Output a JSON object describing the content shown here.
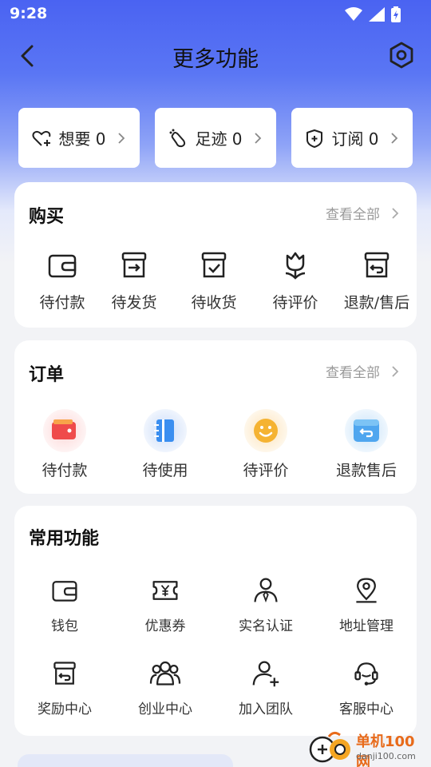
{
  "status_bar": {
    "time": "9:28"
  },
  "nav": {
    "title": "更多功能"
  },
  "quick": [
    {
      "label": "想要 0",
      "icon": "heart-plus-icon"
    },
    {
      "label": "足迹 0",
      "icon": "footprint-icon"
    },
    {
      "label": "订阅 0",
      "icon": "subscribe-icon"
    }
  ],
  "purchase": {
    "title": "购买",
    "view_all": "查看全部",
    "items": [
      {
        "label": "待付款",
        "icon": "wallet-icon"
      },
      {
        "label": "待发货",
        "icon": "box-arrow-icon"
      },
      {
        "label": "待收货",
        "icon": "box-check-icon"
      },
      {
        "label": "待评价",
        "icon": "flower-icon"
      },
      {
        "label": "退款/售后",
        "icon": "box-return-icon"
      }
    ]
  },
  "orders": {
    "title": "订单",
    "view_all": "查看全部",
    "items": [
      {
        "label": "待付款",
        "icon": "red-wallet-icon"
      },
      {
        "label": "待使用",
        "icon": "blue-notebook-icon"
      },
      {
        "label": "待评价",
        "icon": "smiley-icon"
      },
      {
        "label": "退款售后",
        "icon": "blue-return-icon"
      }
    ]
  },
  "common": {
    "title": "常用功能",
    "items": [
      {
        "label": "钱包",
        "icon": "wallet-icon"
      },
      {
        "label": "优惠券",
        "icon": "coupon-icon"
      },
      {
        "label": "实名认证",
        "icon": "person-tie-icon"
      },
      {
        "label": "地址管理",
        "icon": "location-pin-icon"
      },
      {
        "label": "奖励中心",
        "icon": "box-return-icon"
      },
      {
        "label": "创业中心",
        "icon": "group-icon"
      },
      {
        "label": "加入团队",
        "icon": "person-add-icon"
      },
      {
        "label": "客服中心",
        "icon": "headset-icon"
      }
    ]
  },
  "watermark": {
    "line1": "单机100网",
    "line2": "danji100.com"
  },
  "colors": {
    "header_top": "#4a63f2",
    "accent_red": "#ef4b4b",
    "accent_blue": "#3a8ef0",
    "accent_yellow": "#f5b332"
  }
}
